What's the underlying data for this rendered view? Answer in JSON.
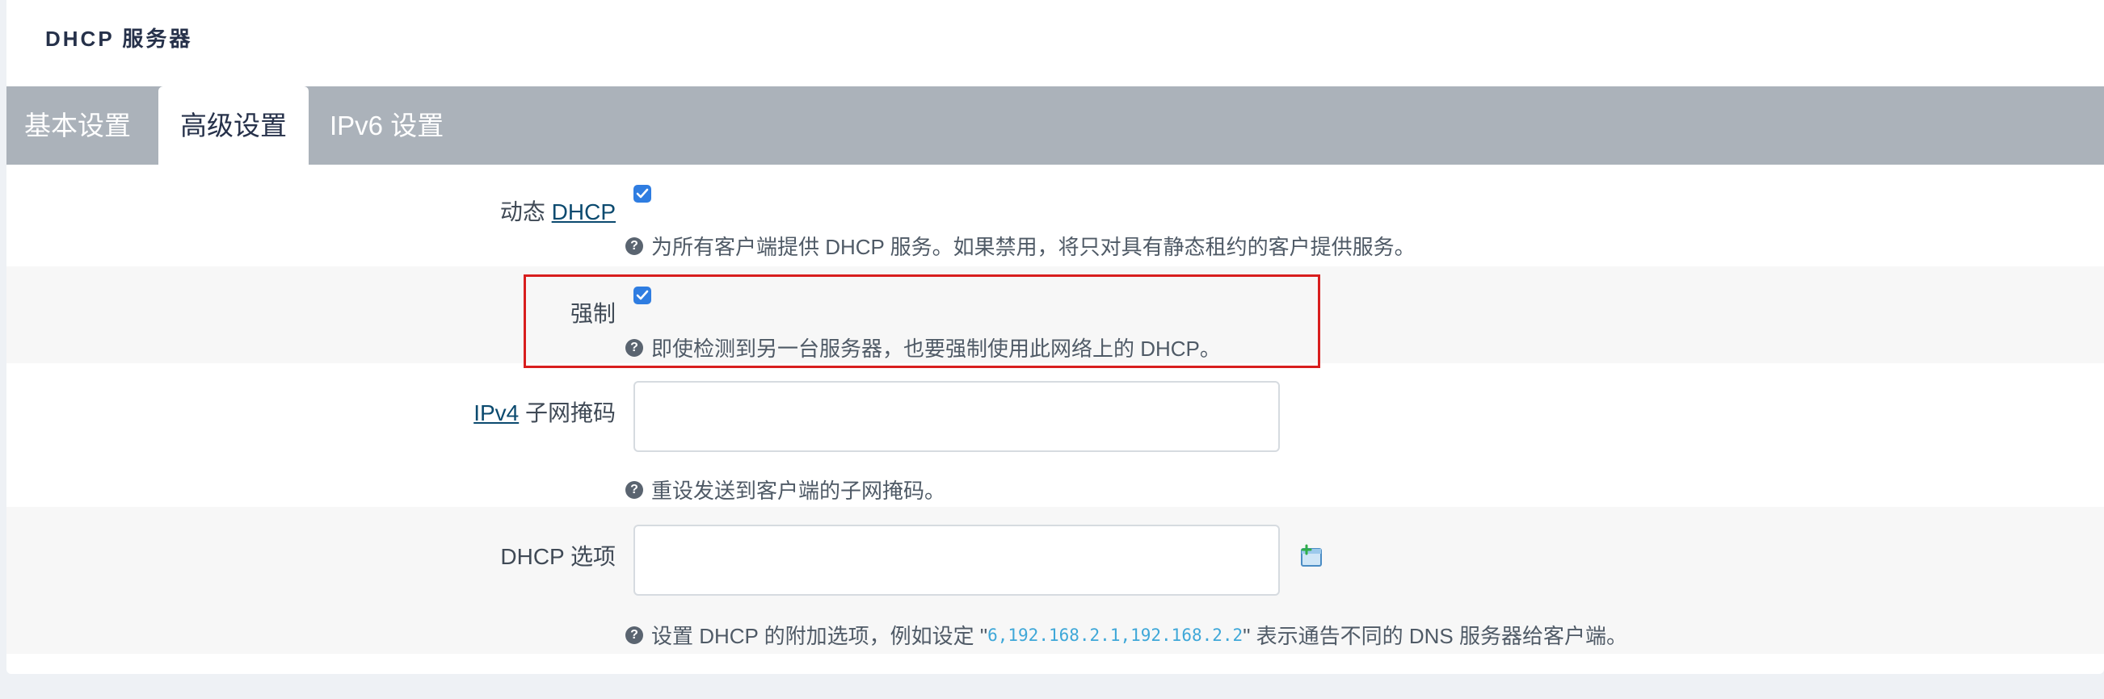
{
  "panel": {
    "title": "DHCP 服务器"
  },
  "tabs": [
    {
      "label": "基本设置",
      "active": false
    },
    {
      "label": "高级设置",
      "active": true
    },
    {
      "label": "IPv6 设置",
      "active": false
    }
  ],
  "fields": {
    "dynamic_dhcp": {
      "label_prefix": "动态 ",
      "label_link": "DHCP",
      "checked": true,
      "help": "为所有客户端提供 DHCP 服务。如果禁用，将只对具有静态租约的客户提供服务。"
    },
    "force": {
      "label": "强制",
      "checked": true,
      "help": "即使检测到另一台服务器，也要强制使用此网络上的 DHCP。"
    },
    "ipv4_netmask": {
      "label_link": "IPv4",
      "label_suffix": " 子网掩码",
      "value": "",
      "help": "重设发送到客户端的子网掩码。"
    },
    "dhcp_options": {
      "label": "DHCP 选项",
      "value": "",
      "help_before": "设置 DHCP 的附加选项，例如设定 \"",
      "help_code": "6,192.168.2.1,192.168.2.2",
      "help_after": "\" 表示通告不同的 DNS 服务器给客户端。"
    }
  },
  "icons": {
    "help": "question-circle-icon",
    "checkbox": "checkmark-icon",
    "add": "add-option-icon"
  },
  "colors": {
    "tab_bar": "#abb2ba",
    "checkbox": "#2f7de1",
    "link": "#0b4a6f",
    "highlight": "#d81e1e",
    "code": "#3ea7d8"
  }
}
